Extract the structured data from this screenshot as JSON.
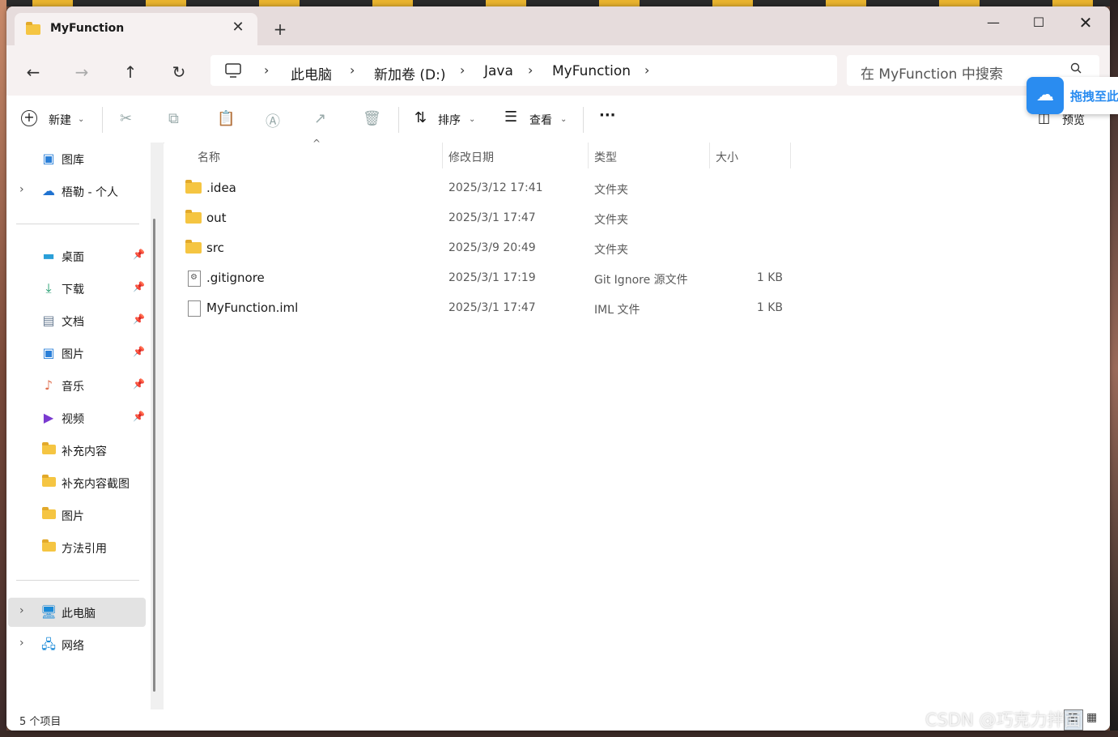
{
  "window": {
    "tab_title": "MyFunction",
    "tab_close": "✕",
    "new_tab": "+",
    "controls": {
      "minimize": "—",
      "maximize": "☐",
      "close": "✕"
    }
  },
  "nav": {
    "back": "←",
    "forward": "→",
    "up": "↑",
    "refresh": "↻",
    "breadcrumbs": [
      "此电脑",
      "新加卷 (D:)",
      "Java",
      "MyFunction"
    ],
    "search_placeholder": "在 MyFunction 中搜索"
  },
  "toolbar": {
    "new_label": "新建",
    "sort_label": "排序",
    "view_label": "查看",
    "more_label": "···",
    "preview_label": "预览"
  },
  "sidebar": {
    "top_items": [
      {
        "label": "图库",
        "icon": "gallery-icon"
      },
      {
        "label": "梧勒 - 个人",
        "icon": "onedrive-icon"
      }
    ],
    "pinned_items": [
      {
        "label": "桌面",
        "icon": "desktop-icon"
      },
      {
        "label": "下载",
        "icon": "download-icon"
      },
      {
        "label": "文档",
        "icon": "documents-icon"
      },
      {
        "label": "图片",
        "icon": "pictures-icon"
      },
      {
        "label": "音乐",
        "icon": "music-icon"
      },
      {
        "label": "视频",
        "icon": "video-icon"
      }
    ],
    "folder_items": [
      {
        "label": "补充内容",
        "icon": "folder-icon"
      },
      {
        "label": "补充内容截图",
        "icon": "folder-icon"
      },
      {
        "label": "图片",
        "icon": "folder-icon"
      },
      {
        "label": "方法引用",
        "icon": "folder-icon"
      }
    ],
    "bottom_items": [
      {
        "label": "此电脑",
        "icon": "this-pc-icon"
      },
      {
        "label": "网络",
        "icon": "network-icon"
      }
    ]
  },
  "columns": {
    "name": "名称",
    "date": "修改日期",
    "type": "类型",
    "size": "大小"
  },
  "files": [
    {
      "name": ".idea",
      "date": "2025/3/12 17:41",
      "type": "文件夹",
      "size": "",
      "kind": "folder"
    },
    {
      "name": "out",
      "date": "2025/3/1 17:47",
      "type": "文件夹",
      "size": "",
      "kind": "folder"
    },
    {
      "name": "src",
      "date": "2025/3/9 20:49",
      "type": "文件夹",
      "size": "",
      "kind": "folder"
    },
    {
      "name": ".gitignore",
      "date": "2025/3/1 17:19",
      "type": "Git Ignore 源文件",
      "size": "1 KB",
      "kind": "file"
    },
    {
      "name": "MyFunction.iml",
      "date": "2025/3/1 17:47",
      "type": "IML 文件",
      "size": "1 KB",
      "kind": "file"
    }
  ],
  "status": {
    "count_text": "5 个项目"
  },
  "overlay": {
    "baidu_text": "拖拽至此",
    "watermark": "CSDN @巧克力拌面"
  },
  "colors": {
    "folder": "#f5c542",
    "accent": "#2a8cf0",
    "selected": "#e3e3e3"
  }
}
